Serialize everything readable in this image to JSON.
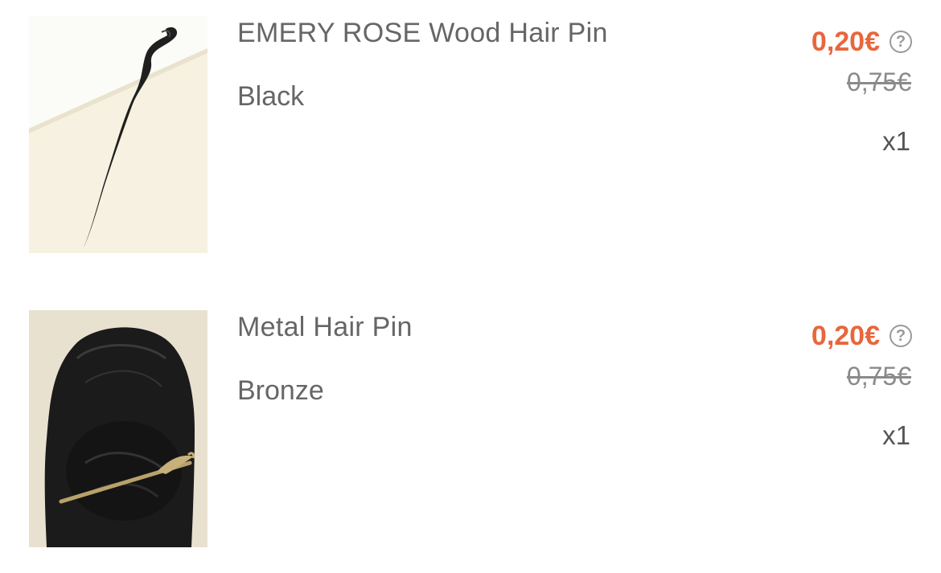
{
  "items": [
    {
      "title": "EMERY ROSE Wood Hair Pin",
      "variant": "Black",
      "price": "0,20€",
      "original_price": "0,75€",
      "quantity": "x1",
      "image": "black-wooden-hair-stick-photo"
    },
    {
      "title": "Metal Hair Pin",
      "variant": "Bronze",
      "price": "0,20€",
      "original_price": "0,75€",
      "quantity": "x1",
      "image": "bronze-hair-pin-in-bun-photo"
    }
  ],
  "colors": {
    "price": "#e8663d",
    "text": "#666666",
    "muted": "#8a8a8a"
  },
  "icons": {
    "help": "question-circle-icon"
  }
}
